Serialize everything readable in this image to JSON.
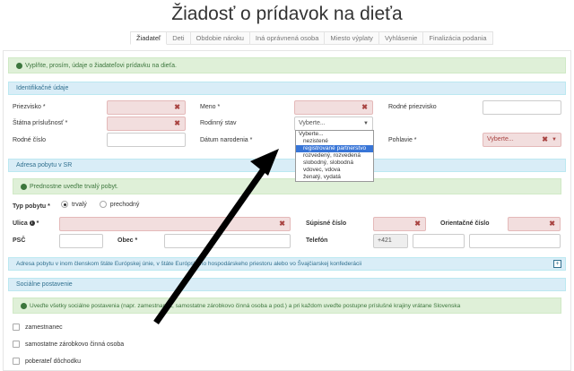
{
  "title": "Žiadosť o prídavok na dieťa",
  "tabs": [
    "Žiadateľ",
    "Deti",
    "Obdobie nároku",
    "Iná oprávnená osoba",
    "Miesto výplaty",
    "Vyhlásenie",
    "Finalizácia podania"
  ],
  "intro_alert": "Vyplňte, prosím, údaje o žiadateľovi prídavku na dieťa.",
  "identification": {
    "heading": "Identifikačné údaje",
    "surname_label": "Priezvisko *",
    "name_label": "Meno *",
    "birth_surname_label": "Rodné priezvisko",
    "citizenship_label": "Štátna príslušnosť *",
    "marital_label": "Rodinný stav",
    "marital_value": "Vyberte...",
    "birth_number_label": "Rodné číslo",
    "birth_date_label": "Dátum narodenia *",
    "gender_label": "Pohlavie *",
    "gender_value": "Vyberte..."
  },
  "marital_options": [
    "Vyberte...",
    "nezistené",
    "registrované partnerstvo",
    "rozvedený, rozvedená",
    "slobodný, slobodná",
    "vdovec, vdova",
    "ženatý, vydatá"
  ],
  "residence": {
    "heading": "Adresa pobytu v SR",
    "alert": "Prednostne uveďte trvalý pobyt.",
    "type_label": "Typ pobytu *",
    "opt_permanent": "trvalý",
    "opt_temporary": "prechodný",
    "street_label": "Ulica",
    "street_req": "*",
    "reg_number_label": "Súpisné číslo",
    "orient_number_label": "Orientačné číslo",
    "zip_label": "PSČ",
    "town_label": "Obec *",
    "phone_label": "Telefón",
    "phone_prefix": "+421"
  },
  "eu_address_heading": "Adresa pobytu v inom členskom štáte Európskej únie, v štáte Európskeho hospodárskeho priestoru alebo vo Švajčiarskej konfederácii",
  "social": {
    "heading": "Sociálne postavenie",
    "alert": "Uveďte všetky sociálne postavenia (napr. zamestnanec, samostatne zárobkovo činná osoba a pod.) a pri každom uveďte postupne príslušné krajiny vrátane Slovenska",
    "options": [
      "zamestnanec",
      "samostatne zárobkovo činná osoba",
      "poberateľ dôchodku"
    ]
  },
  "icons": {
    "clear": "✖",
    "caret": "▼",
    "info": "i",
    "expand": "+"
  },
  "colors": {
    "required_bg": "#f2dede",
    "alert_bg": "#dff0d8",
    "section_bg": "#d9edf7",
    "highlight": "#3875d7"
  }
}
